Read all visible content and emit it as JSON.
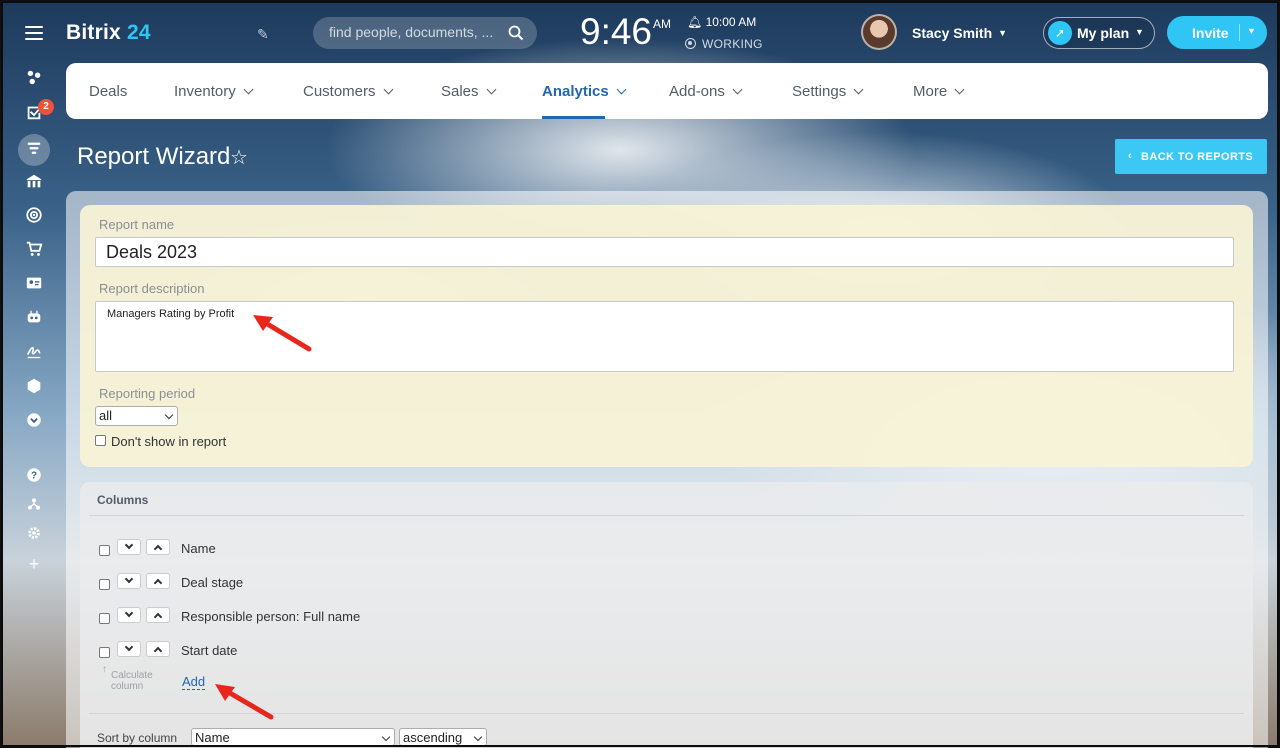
{
  "topbar": {
    "logo_main": "Bitrix",
    "logo_accent": "24",
    "search_placeholder": "find people, documents, ...",
    "clock": "9:46",
    "ampm": "AM",
    "alarm": "10:00 AM",
    "work_status": "WORKING",
    "user_name": "Stacy Smith",
    "my_plan": "My plan",
    "invite": "Invite"
  },
  "sidebar": {
    "tasks_badge": "2"
  },
  "menu": {
    "items": [
      "Deals",
      "Inventory",
      "Customers",
      "Sales",
      "Analytics",
      "Add-ons",
      "Settings",
      "More"
    ],
    "active": "Analytics"
  },
  "page": {
    "title": "Report Wizard",
    "back_button": "BACK TO REPORTS"
  },
  "form": {
    "report_name_label": "Report name",
    "report_name_value": "Deals 2023",
    "report_description_label": "Report description",
    "report_description_value": "Managers Rating by Profit",
    "reporting_period_label": "Reporting period",
    "reporting_period_value": "all",
    "dont_show_label": "Don't show in report"
  },
  "columns": {
    "title": "Columns",
    "rows": [
      "Name",
      "Deal stage",
      "Responsible person: Full name",
      "Start date"
    ],
    "calculate_label_1": "Calculate",
    "calculate_label_2": "column",
    "add_link": "Add"
  },
  "sort": {
    "label": "Sort by column",
    "column_value": "Name",
    "order_value": "ascending"
  },
  "colors": {
    "accent": "#2fc6f6",
    "active_menu": "#2067b0",
    "annotation_arrow": "#e8261c"
  }
}
